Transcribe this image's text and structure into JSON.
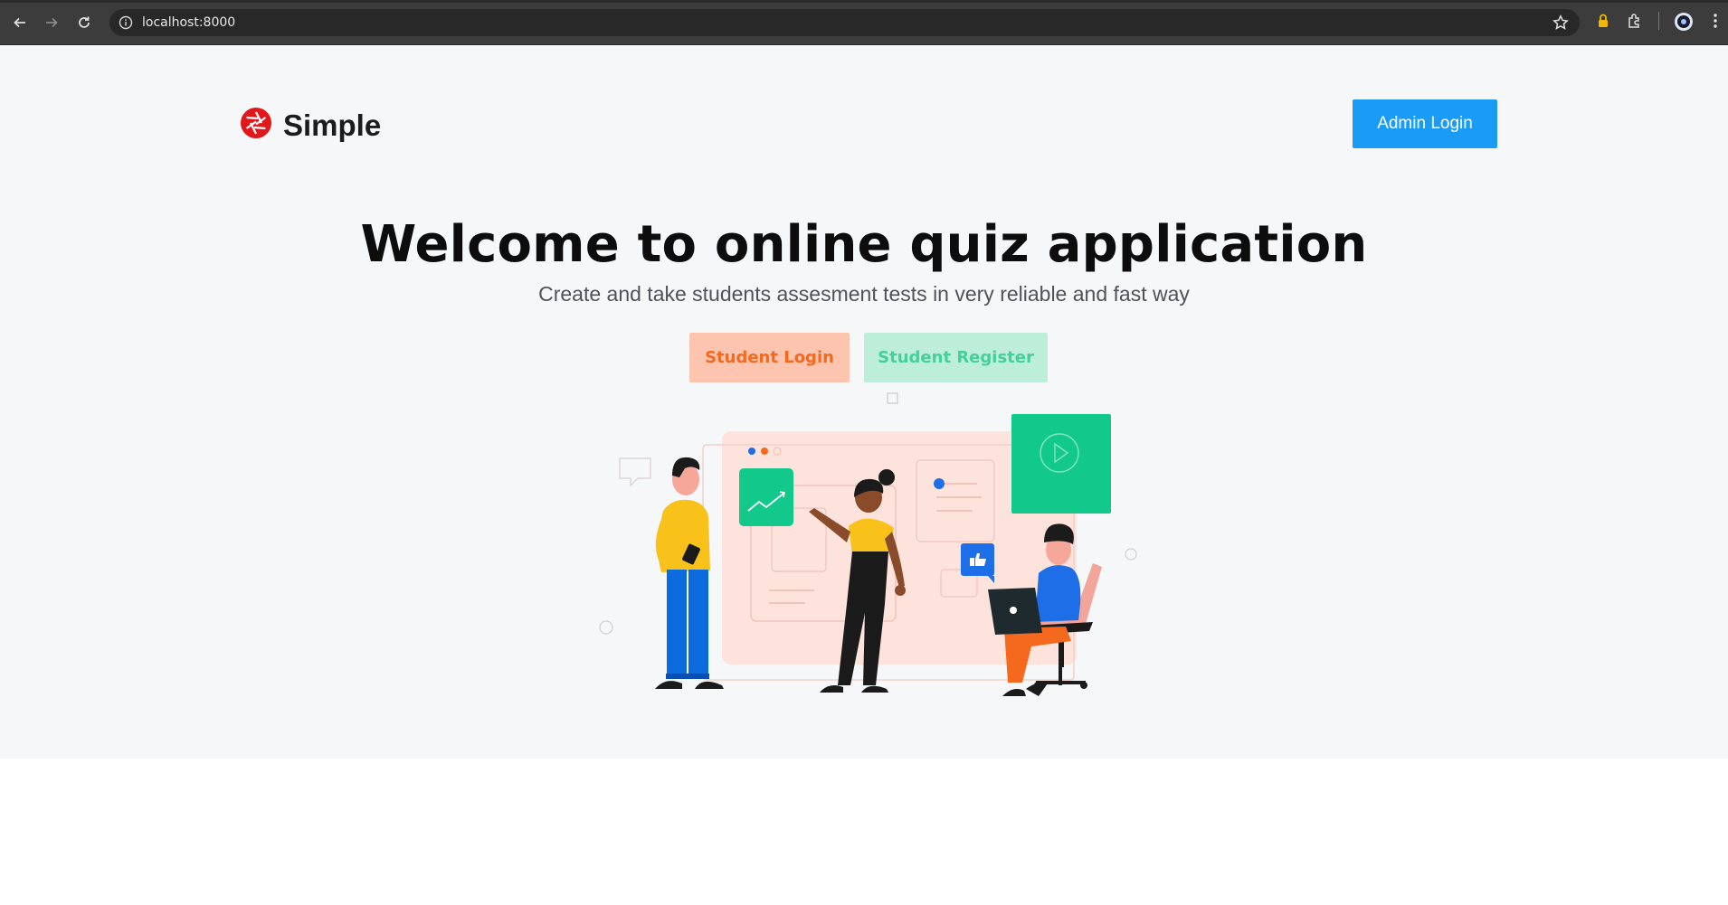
{
  "browser": {
    "url": "localhost:8000",
    "icons": [
      "back-arrow-icon",
      "forward-arrow-icon",
      "reload-icon",
      "site-info-icon",
      "bookmark-star-icon",
      "lock-badge-icon",
      "extensions-icon",
      "profile-icon",
      "menu-kebab-icon"
    ]
  },
  "header": {
    "brand": "Simple",
    "admin_login_label": "Admin Login"
  },
  "hero": {
    "title": "Welcome to online quiz application",
    "subtitle": "Create and take students assesment tests in very reliable and fast way",
    "student_login_label": "Student Login",
    "student_register_label": "Student Register"
  },
  "colors": {
    "admin_button": "#1a9cf6",
    "student_login_bg": "#fdc5b0",
    "student_login_text": "#f4691e",
    "student_register_bg": "#bdeed9",
    "student_register_text": "#45d09a",
    "logo_red": "#e0181b",
    "page_bg": "#f6f7f9"
  }
}
